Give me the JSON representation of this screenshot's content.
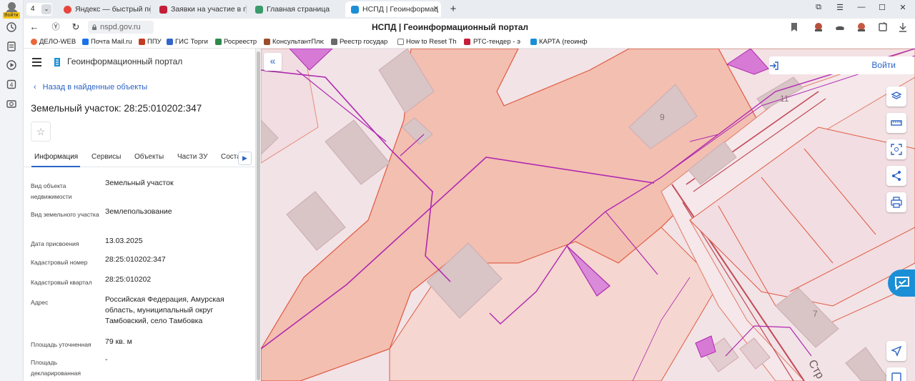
{
  "browser": {
    "profile_label": "Войти",
    "tab_count": "4",
    "tabs": [
      {
        "title": "Яндекс — быстрый поиск",
        "favicon_color": "#e8453c"
      },
      {
        "title": "Заявки на участие в п",
        "favicon_color": "#c41e3a"
      },
      {
        "title": "Главная страница",
        "favicon_color": "#3a9a6b"
      },
      {
        "title": "НСПД | Геоинформац",
        "favicon_color": "#1b8fd6",
        "active": true
      }
    ],
    "url": "nspd.gov.ru",
    "page_title": "НСПД | Геоинформационный портал",
    "bookmarks": [
      {
        "label": "ДЕЛО-WEB",
        "color": "#e9673a"
      },
      {
        "label": "Почта Mail.ru",
        "color": "#1a73e8"
      },
      {
        "label": "ППУ",
        "color": "#c23b22"
      },
      {
        "label": "ГИС Торги",
        "color": "#3366cc"
      },
      {
        "label": "Росреестр",
        "color": "#2f8a4d"
      },
      {
        "label": "КонсультантПлюс",
        "color": "#9b4d2a"
      },
      {
        "label": "Реестр государ",
        "color": "#6b6b6b"
      },
      {
        "label": "How to Reset Th",
        "color": "#777777"
      },
      {
        "label": "РТС-тендер - э",
        "color": "#c41e3a"
      },
      {
        "label": "КАРТА (геоинф",
        "color": "#1b8fd6"
      }
    ]
  },
  "panel": {
    "app_title": "Геоинформационный портал",
    "back_label": "Назад в найденные объекты",
    "object_title": "Земельный участок: 28:25:010202:347",
    "tabs": [
      "Информация",
      "Сервисы",
      "Объекты",
      "Части ЗУ",
      "Соста"
    ],
    "fields": [
      {
        "key": "Вид объекта недвижимости",
        "value": "Земельный участок"
      },
      {
        "key": "Вид земельного участка",
        "value": "Землепользование"
      },
      {
        "key": "Дата присвоения",
        "value": "13.03.2025"
      },
      {
        "key": "Кадастровый номер",
        "value": "28:25:010202:347"
      },
      {
        "key": "Кадастровый квартал",
        "value": "28:25:010202"
      },
      {
        "key": "Адрес",
        "value": "Российская Федерация, Амурская область, муниципальный округ Тамбовский, село Тамбовка"
      },
      {
        "key": "Площадь уточненная",
        "value": "79 кв. м"
      },
      {
        "key": "Площадь декларированная",
        "value": "-"
      }
    ]
  },
  "map": {
    "login_label": "Войти",
    "labels": [
      "9",
      "11",
      "7",
      "Стр"
    ],
    "colors": {
      "parcel_fill": "#f3bfb1",
      "parcel_stroke": "#e05a40",
      "network": "#b02ab0",
      "building": "#d9c4c6",
      "accent": "#2b63c6"
    }
  }
}
